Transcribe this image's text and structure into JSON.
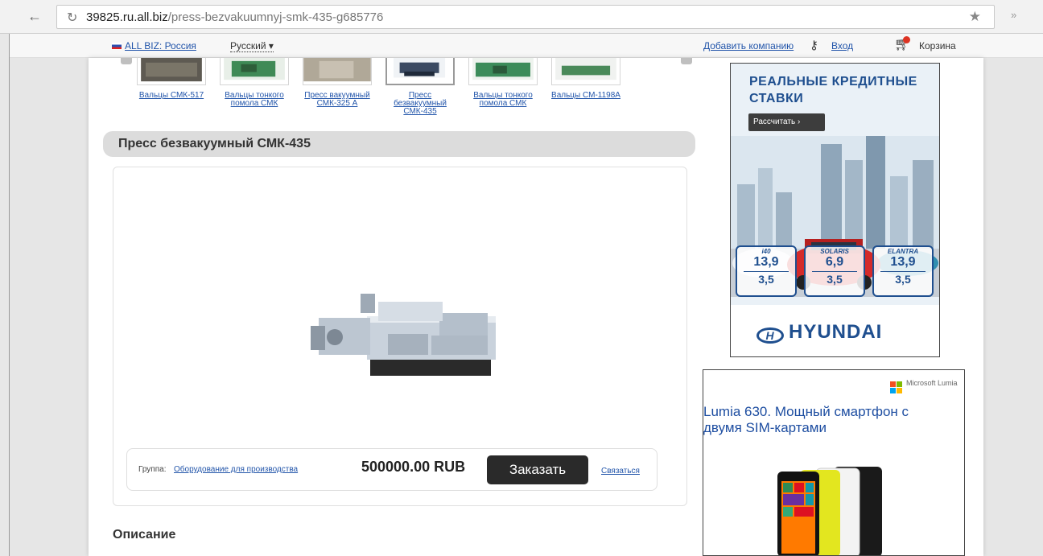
{
  "browser": {
    "url_host": "39825.ru.all.biz",
    "url_path": "/press-bezvakuumnyj-smk-435-g685776"
  },
  "site_bar": {
    "region_link": "ALL BIZ: Россия",
    "language": "Русский ▾",
    "add_company": "Добавить компанию",
    "login": "Вход",
    "cart": "Корзина"
  },
  "thumbnails": [
    {
      "caption": "Вальцы СМК-517"
    },
    {
      "caption": "Вальцы тонкого помола СМК"
    },
    {
      "caption": "Пресс вакуумный СМК-325 А"
    },
    {
      "caption": "Пресс безвакуумный СМК-435"
    },
    {
      "caption": "Вальцы тонкого помола СМК"
    },
    {
      "caption": "Вальцы СМ-1198А"
    }
  ],
  "product": {
    "title": "Пресс безвакуумный СМК-435",
    "group_label": "Группа:",
    "group_link": "Оборудование для производства",
    "price": "500000.00 RUB",
    "order_button": "Заказать",
    "contact_link": "Связаться",
    "description_heading": "Описание"
  },
  "ad_hyundai": {
    "headline": "РЕАЛЬНЫЕ КРЕДИТНЫЕ СТАВКИ",
    "button": "Рассчитать ›",
    "rates": [
      {
        "model": "i40",
        "rate": "13,9",
        "sub": "3,5"
      },
      {
        "model": "SOLARIS",
        "rate": "6,9",
        "sub": "3,5"
      },
      {
        "model": "ELANTRA",
        "rate": "13,9",
        "sub": "3,5"
      }
    ],
    "brand": "HYUNDAI",
    "colors": {
      "accent": "#1f4f8f",
      "car": "#d42a2a"
    }
  },
  "ad_lumia": {
    "brand": "Microsoft Lumia",
    "headline": "Lumia 630. Мощный смартфон с двумя SIM-картами",
    "colors": {
      "accent": "#1e4ea1"
    }
  }
}
